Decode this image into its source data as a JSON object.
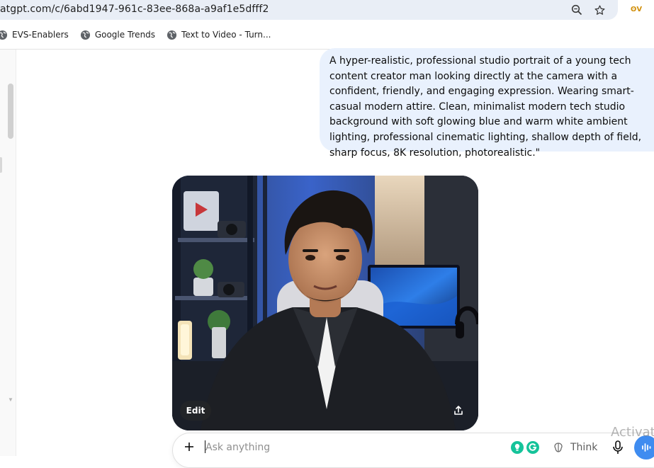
{
  "browser": {
    "url": "atgpt.com/c/6abd1947-961c-83ee-868a-a9af1e5dfff2",
    "extension_badge": "ʘV",
    "bookmarks": [
      {
        "label": "EVS-Enablers",
        "icon": "globe-icon"
      },
      {
        "label": "Google Trends",
        "icon": "globe-icon"
      },
      {
        "label": "Text to Video - Turn..."
      }
    ]
  },
  "conversation": {
    "user_message": "A hyper-realistic, professional studio portrait of a young tech content creator man looking directly at the camera with a confident, friendly, and engaging expression. Wearing smart-casual modern attire. Clean, minimalist modern tech studio background with soft glowing blue and warm white ambient lighting, professional cinematic lighting, shallow depth of field, sharp focus, 8K resolution, photorealistic.\"",
    "image_actions": {
      "edit_label": "Edit",
      "share_icon": "share-icon"
    }
  },
  "composer": {
    "placeholder": "Ask anything",
    "think_label": "Think",
    "colors": {
      "voice_button": "#3f8cf0",
      "grammarly": "#15c39a"
    }
  },
  "watermark": "Activat"
}
